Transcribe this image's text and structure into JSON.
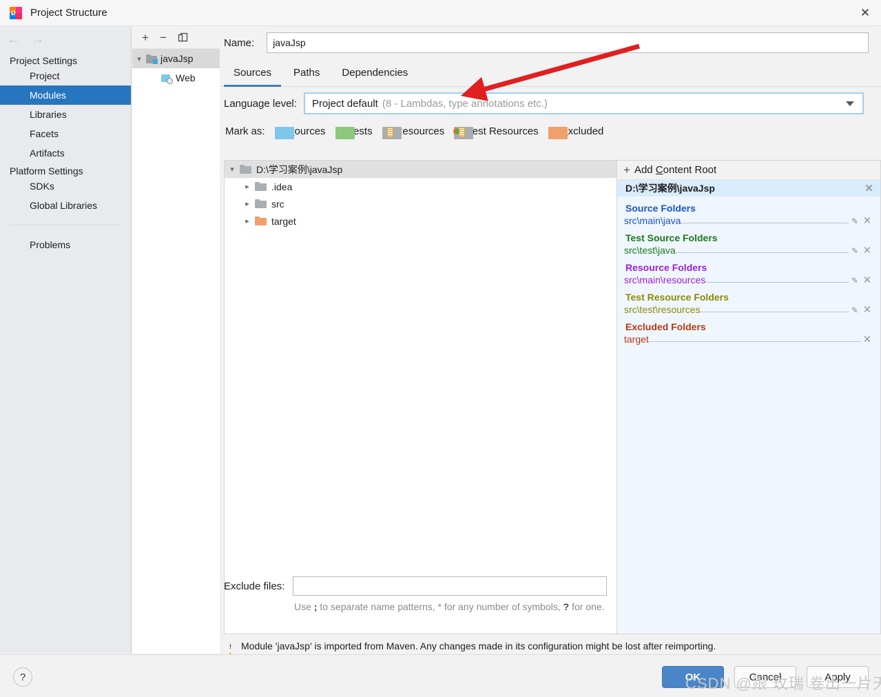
{
  "window": {
    "title": "Project Structure",
    "app_icon": "intellij-idea-icon",
    "close_label": "✕"
  },
  "sidebar": {
    "back_icon": "←",
    "forward_icon": "→",
    "groups": [
      {
        "label": "Project Settings",
        "items": [
          {
            "label": "Project",
            "selected": false
          },
          {
            "label": "Modules",
            "selected": true
          },
          {
            "label": "Libraries",
            "selected": false
          },
          {
            "label": "Facets",
            "selected": false
          },
          {
            "label": "Artifacts",
            "selected": false
          }
        ]
      },
      {
        "label": "Platform Settings",
        "items": [
          {
            "label": "SDKs",
            "selected": false
          },
          {
            "label": "Global Libraries",
            "selected": false
          }
        ]
      }
    ],
    "problems_label": "Problems"
  },
  "modules_panel": {
    "toolbar": {
      "add_label": "+",
      "remove_label": "−",
      "copy_label": "copy-icon"
    },
    "tree": [
      {
        "label": "javaJsp",
        "selected": true,
        "expanded": true,
        "icon": "module-folder-icon",
        "indent": 0
      },
      {
        "label": "Web",
        "selected": false,
        "expanded": false,
        "icon": "web-facet-icon",
        "indent": 1
      }
    ]
  },
  "main": {
    "name_label": "Name:",
    "name_value": "javaJsp",
    "tabs": [
      {
        "label": "Sources",
        "active": true
      },
      {
        "label": "Paths",
        "active": false
      },
      {
        "label": "Dependencies",
        "active": false
      }
    ],
    "language_level": {
      "label": "Language level:",
      "value": "Project default",
      "hint": "(8 - Lambdas, type annotations etc.)",
      "caret_icon": "chevron-down-icon"
    },
    "mark_as": {
      "label": "Mark as:",
      "items": [
        {
          "label": "Sources",
          "mnemonic": "S",
          "color": "#7fc6ea"
        },
        {
          "label": "Tests",
          "mnemonic": "T",
          "color": "#8cc97f"
        },
        {
          "label": "Resources",
          "mnemonic": "",
          "color": "#a8aeb4"
        },
        {
          "label": "Test Resources",
          "mnemonic": "",
          "color": "#a8aeb4"
        },
        {
          "label": "Excluded",
          "mnemonic": "E",
          "color": "#f0a06a"
        }
      ]
    }
  },
  "file_tree": [
    {
      "label": "D:\\学习案例\\javaJsp",
      "indent": 0,
      "expanded": true,
      "selected": true,
      "color": "#a8aeb4"
    },
    {
      "label": ".idea",
      "indent": 1,
      "expanded": false,
      "selected": false,
      "color": "#a8aeb4"
    },
    {
      "label": "src",
      "indent": 1,
      "expanded": false,
      "selected": false,
      "color": "#a8aeb4"
    },
    {
      "label": "target",
      "indent": 1,
      "expanded": false,
      "selected": false,
      "color": "#f0a06a"
    }
  ],
  "content_roots": {
    "add_label": "Add Content Root",
    "add_mnemonic": "C",
    "root_path": "D:\\学习案例\\javaJsp",
    "remove_icon": "✕",
    "groups": [
      {
        "title": "Source Folders",
        "color": "#1a56c4",
        "paths": [
          {
            "path": "src\\main\\java",
            "editable": true
          }
        ]
      },
      {
        "title": "Test Source Folders",
        "color": "#177a1b",
        "paths": [
          {
            "path": "src\\test\\java",
            "editable": true
          }
        ]
      },
      {
        "title": "Resource Folders",
        "color": "#9b21d6",
        "paths": [
          {
            "path": "src\\main\\resources",
            "editable": true
          }
        ]
      },
      {
        "title": "Test Resource Folders",
        "color": "#8a8a06",
        "paths": [
          {
            "path": "src\\test\\resources",
            "editable": true
          }
        ]
      },
      {
        "title": "Excluded Folders",
        "color": "#b33a10",
        "paths": [
          {
            "path": "target",
            "editable": false
          }
        ]
      }
    ]
  },
  "exclude": {
    "label": "Exclude files:",
    "value": "",
    "placeholder": "",
    "hint_pre": "Use ",
    "hint_semi": ";",
    "hint_mid": " to separate name patterns, * for any number of symbols, ",
    "hint_q": "?",
    "hint_post": " for one."
  },
  "warning": {
    "icon": "warning-triangle-icon",
    "text": "Module 'javaJsp' is imported from Maven. Any changes made in its configuration might be lost after reimporting."
  },
  "footer": {
    "help_label": "?",
    "ok_label": "OK",
    "cancel_label": "Cancel",
    "apply_label": "Apply"
  },
  "annotation": {
    "arrow_color": "#e02020",
    "watermark": "CSDN @跟 玫瑞 卷出一片天"
  },
  "colors": {
    "accent": "#2675bf",
    "tab_underline": "#3f7fbf",
    "selection": "#2675bf",
    "primary_button": "#4a86c7"
  }
}
